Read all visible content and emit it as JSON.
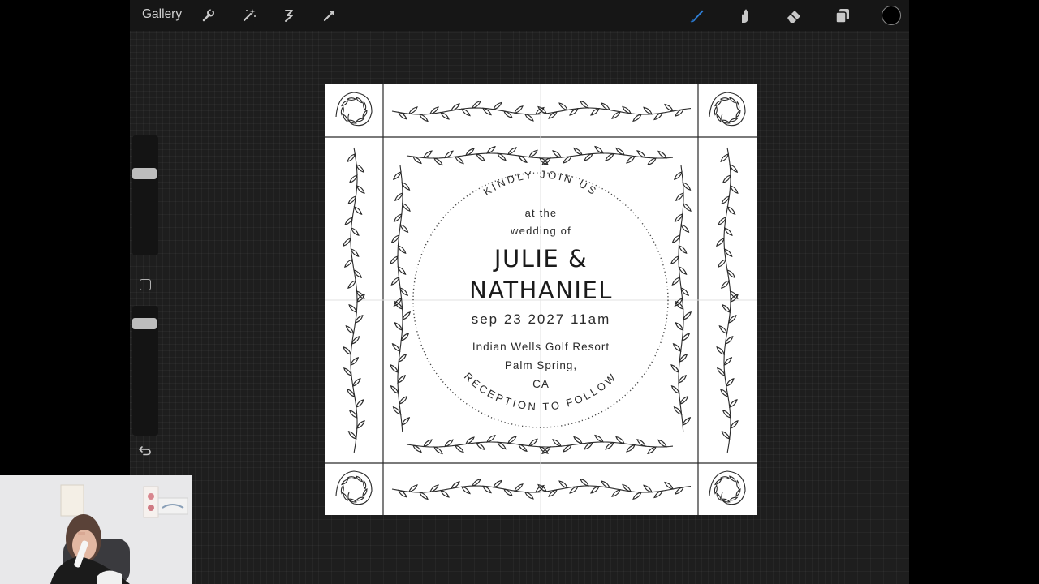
{
  "toolbar": {
    "gallery_label": "Gallery",
    "left_tools": [
      "wrench-icon",
      "magic-wand-icon",
      "selection-icon",
      "transform-arrow-icon"
    ],
    "right_tools": [
      "brush-icon",
      "smudge-icon",
      "eraser-icon",
      "layers-icon"
    ],
    "active_tool": "brush-icon",
    "accent_color": "#2f7fd6",
    "current_color": "#000000"
  },
  "sidebar": {
    "brush_size": 0.7,
    "opacity": 0.9,
    "icons": [
      "modify-square-icon",
      "undo-icon"
    ]
  },
  "invitation": {
    "arc_top": "KINDLY JOIN US",
    "line1": "at the",
    "line2": "wedding of",
    "name1": "JULIE &",
    "name2": "NATHANIEL",
    "date": "sep 23 2027 11am",
    "venue1": "Indian Wells Golf Resort",
    "venue2": "Palm Spring,",
    "venue3": "CA",
    "arc_bottom": "RECEPTION TO FOLLOW"
  },
  "colors": {
    "app_bg": "#1e1e1e",
    "topbar_bg": "#161616",
    "canvas_bg": "#ffffff",
    "ink": "#2a2a2a"
  }
}
